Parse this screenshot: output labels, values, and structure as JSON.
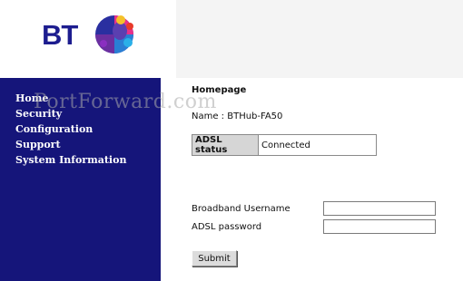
{
  "brand": {
    "logo_text": "BT"
  },
  "sidebar": {
    "items": [
      {
        "label": "Home"
      },
      {
        "label": "Security"
      },
      {
        "label": "Configuration"
      },
      {
        "label": "Support"
      },
      {
        "label": "System Information"
      }
    ]
  },
  "watermark": "PortForward.com",
  "main": {
    "title": "Homepage",
    "name_line": "Name : BTHub-FA50",
    "status": {
      "label": "ADSL status",
      "value": "Connected"
    },
    "form": {
      "username_label": "Broadband Username",
      "username_value": "",
      "password_label": "ADSL password",
      "password_value": "",
      "submit_label": "Submit"
    }
  },
  "colors": {
    "sidebar_bg": "#15157a",
    "brand_blue": "#1d1d8f",
    "header_right_bg": "#f4f4f4"
  }
}
